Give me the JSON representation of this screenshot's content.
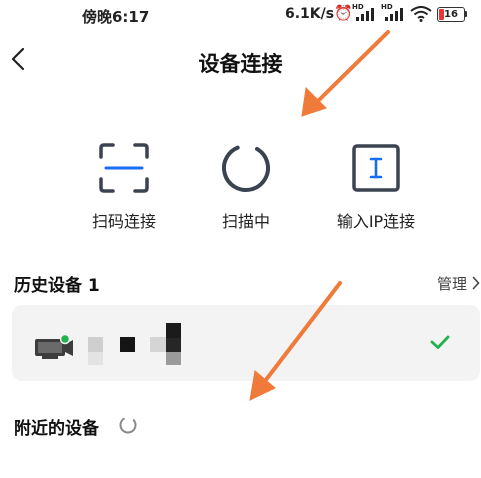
{
  "status_bar": {
    "time": "傍晚6:17",
    "net_speed": "6.1K/s",
    "battery": "16",
    "icons": [
      "alarm-icon",
      "signal-icon",
      "signal-icon",
      "wifi-icon",
      "battery-icon"
    ]
  },
  "header": {
    "title": "设备连接",
    "back_icon": "chevron-left-icon"
  },
  "actions": [
    {
      "label": "扫码连接",
      "icon": "scan-frame-icon"
    },
    {
      "label": "扫描中",
      "icon": "loading-ring-icon"
    },
    {
      "label": "输入IP连接",
      "icon": "text-cursor-box-icon"
    }
  ],
  "history": {
    "title": "历史设备 1",
    "manage_label": "管理",
    "device": {
      "icon": "tv-icon",
      "status_color": "#22b14c",
      "connected_icon": "check-icon"
    }
  },
  "nearby": {
    "title": "附近的设备",
    "icon": "loading-spinner-icon"
  },
  "colors": {
    "accent": "#1a6cf0",
    "scan_line": "#1a6cf0",
    "check": "#22b14c",
    "card_bg": "#f3f3f3",
    "icon_dark": "#3c4350"
  }
}
